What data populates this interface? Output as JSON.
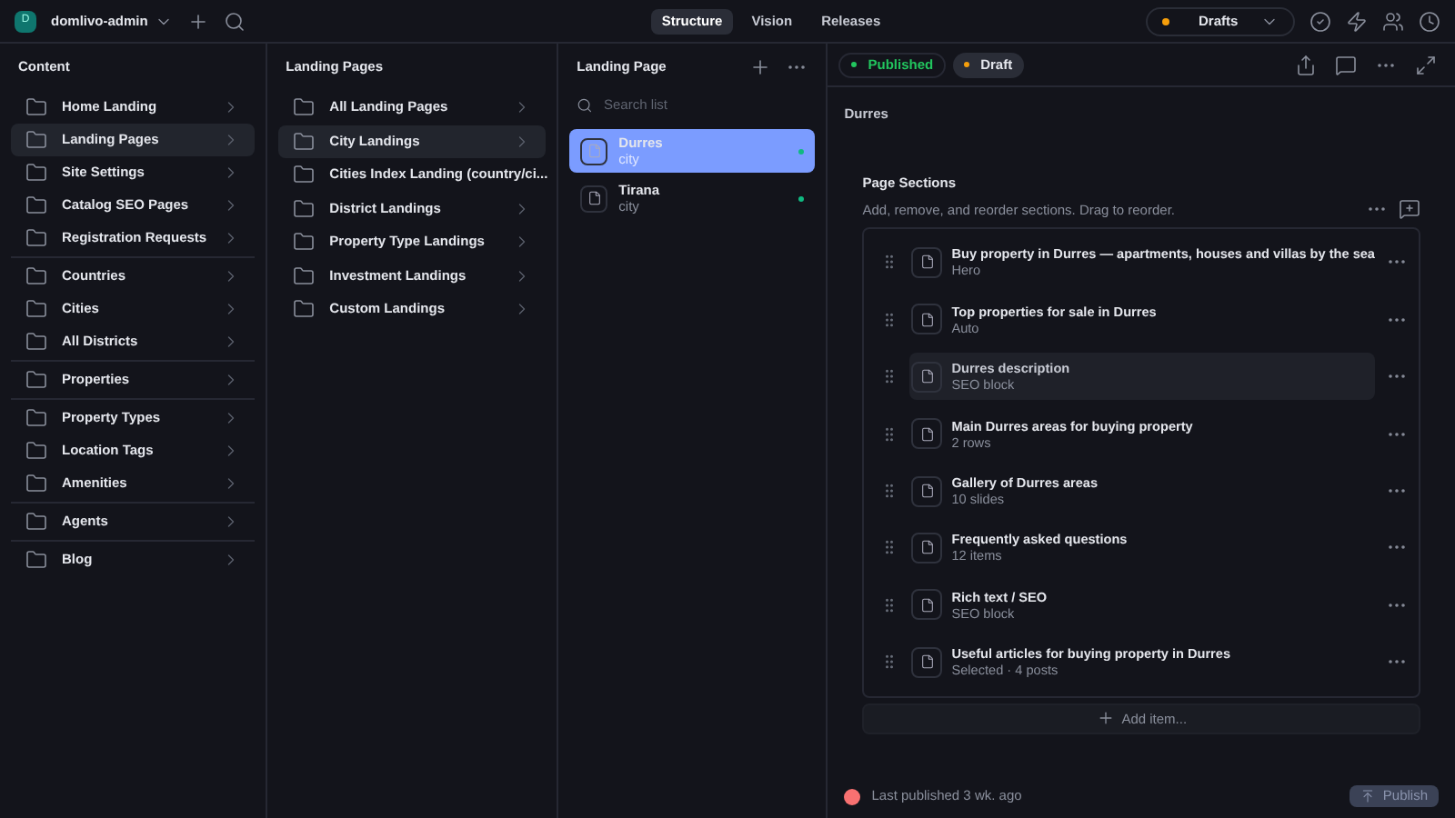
{
  "topbar": {
    "logo_letter": "D",
    "workspace": "domlivo-admin",
    "tabs": [
      {
        "label": "Structure",
        "selected": true
      },
      {
        "label": "Vision",
        "selected": false
      },
      {
        "label": "Releases",
        "selected": false
      }
    ],
    "perspective": {
      "label": "Drafts",
      "color": "#f59e0b"
    }
  },
  "content": {
    "title": "Content",
    "groups": [
      {
        "items": [
          {
            "label": "Home Landing",
            "selected": false
          },
          {
            "label": "Landing Pages",
            "selected": true
          },
          {
            "label": "Site Settings",
            "selected": false
          },
          {
            "label": "Catalog SEO Pages",
            "selected": false
          },
          {
            "label": "Registration Requests",
            "selected": false
          }
        ]
      },
      {
        "items": [
          {
            "label": "Countries",
            "selected": false
          },
          {
            "label": "Cities",
            "selected": false
          },
          {
            "label": "All Districts",
            "selected": false
          }
        ]
      },
      {
        "items": [
          {
            "label": "Properties",
            "selected": false
          }
        ]
      },
      {
        "items": [
          {
            "label": "Property Types",
            "selected": false
          },
          {
            "label": "Location Tags",
            "selected": false
          },
          {
            "label": "Amenities",
            "selected": false
          }
        ]
      },
      {
        "items": [
          {
            "label": "Agents",
            "selected": false
          }
        ]
      },
      {
        "items": [
          {
            "label": "Blog",
            "selected": false
          }
        ]
      }
    ]
  },
  "landing_pages": {
    "title": "Landing Pages",
    "items": [
      {
        "label": "All Landing Pages",
        "selected": false
      },
      {
        "label": "City Landings",
        "selected": true
      },
      {
        "label": "Cities Index Landing (country/ci...",
        "selected": false
      },
      {
        "label": "District Landings",
        "selected": false
      },
      {
        "label": "Property Type Landings",
        "selected": false
      },
      {
        "label": "Investment Landings",
        "selected": false
      },
      {
        "label": "Custom Landings",
        "selected": false
      }
    ]
  },
  "landing_page": {
    "title": "Landing Page",
    "search": {
      "placeholder": "Search list"
    },
    "items": [
      {
        "title": "Durres",
        "subtitle": "city",
        "selected": true,
        "color": "#10b981"
      },
      {
        "title": "Tirana",
        "subtitle": "city",
        "selected": false,
        "color": "#10b981"
      }
    ]
  },
  "document": {
    "status_tabs": [
      {
        "label": "Published",
        "selected": false,
        "color": "#22c55e"
      },
      {
        "label": "Draft",
        "selected": true,
        "color": "#f59e0b"
      }
    ],
    "title": "Durres",
    "field": {
      "label": "Page Sections",
      "description": "Add, remove, and reorder sections. Drag to reorder.",
      "items": [
        {
          "title": "Buy property in Durres — apartments, houses and villas by the sea",
          "subtitle": "Hero",
          "selected": false
        },
        {
          "title": "Top properties for sale in Durres",
          "subtitle": "Auto",
          "selected": false
        },
        {
          "title": "Durres description",
          "subtitle": "SEO block",
          "selected": true
        },
        {
          "title": "Main Durres areas for buying property",
          "subtitle": "2 rows",
          "selected": false
        },
        {
          "title": "Gallery of Durres areas",
          "subtitle": "10 slides",
          "selected": false
        },
        {
          "title": "Frequently asked questions",
          "subtitle": "12 items",
          "selected": false
        },
        {
          "title": "Rich text / SEO",
          "subtitle": "SEO block",
          "selected": false
        },
        {
          "title": "Useful articles for buying property in Durres",
          "subtitle": "Selected · 4 posts",
          "selected": false
        }
      ],
      "add_label": "Add item..."
    },
    "footer": {
      "status": "Last published 3 wk. ago",
      "publish_label": "Publish",
      "publish_disabled": true
    }
  }
}
